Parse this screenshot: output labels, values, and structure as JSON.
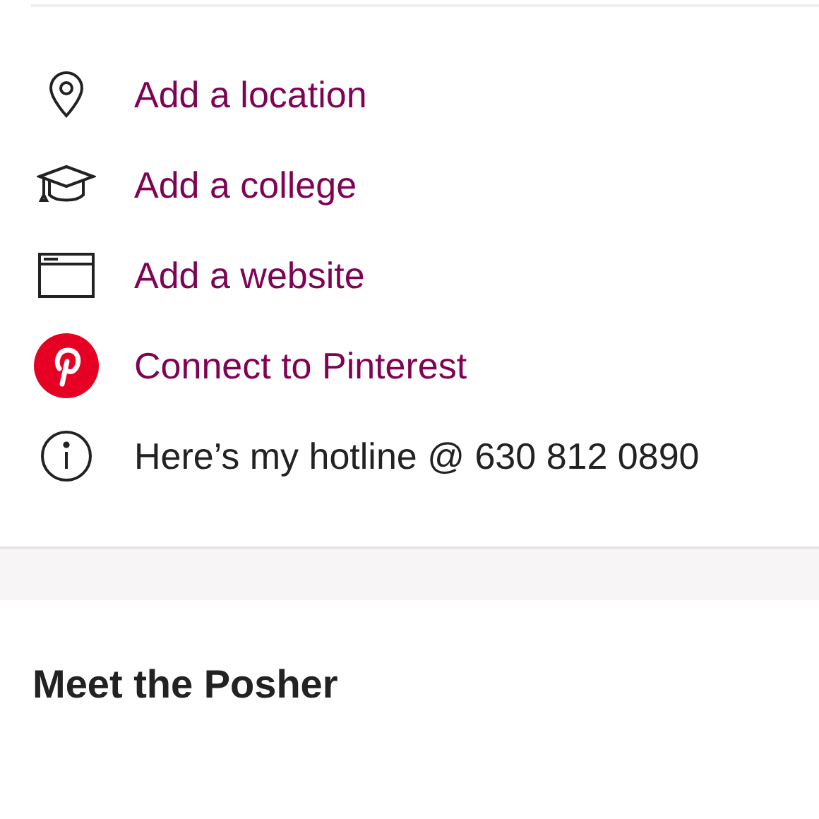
{
  "profile_links": [
    {
      "kind": "location",
      "label": "Add a location",
      "link": true
    },
    {
      "kind": "college",
      "label": "Add a college",
      "link": true
    },
    {
      "kind": "website",
      "label": "Add a website",
      "link": true
    },
    {
      "kind": "pinterest",
      "label": "Connect to Pinterest",
      "link": true
    },
    {
      "kind": "info",
      "label": "Here’s my hotline @ 630 812 0890",
      "link": false
    }
  ],
  "section_heading": "Meet the Posher"
}
